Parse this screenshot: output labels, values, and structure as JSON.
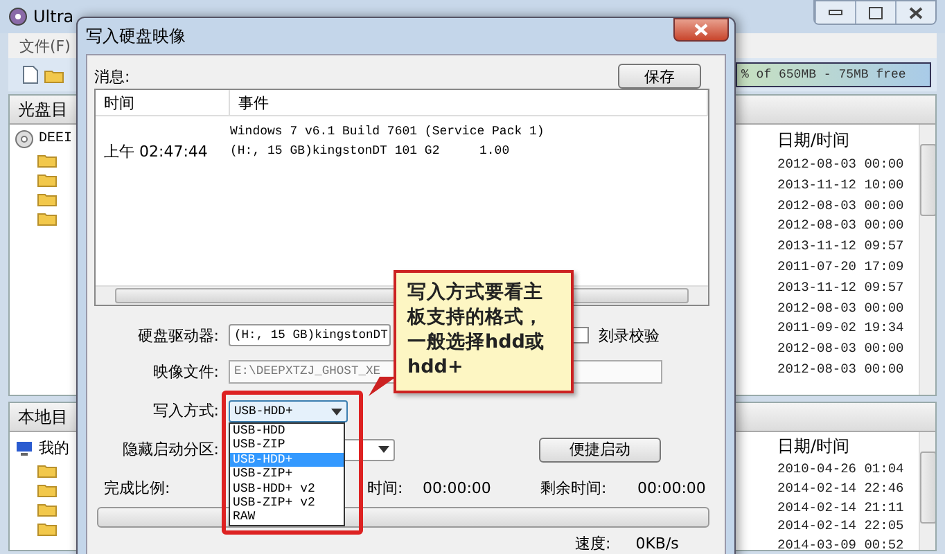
{
  "main_window": {
    "title": "Ultra",
    "menu": [
      "文件(F)"
    ],
    "capacity": "% of 650MB - 75MB free",
    "image_pane": {
      "tab": "光盘目",
      "tree_root": "DEEI",
      "date_header": "日期/时间",
      "dates": [
        "2012-08-03 00:00",
        "2013-11-12 10:00",
        "2012-08-03 00:00",
        "2012-08-03 00:00",
        "2013-11-12 09:57",
        "2011-07-20 17:09",
        "2013-11-12 09:57",
        "2012-08-03 00:00",
        "2011-09-02 19:34",
        "2012-08-03 00:00",
        "2012-08-03 00:00"
      ]
    },
    "local_pane": {
      "tab": "本地目",
      "tree_root": "我的",
      "date_header": "日期/时间",
      "dates": [
        "2010-04-26 01:04",
        "2014-02-14 22:46",
        "2014-02-14 21:11",
        "2014-02-14 22:05",
        "2014-03-09 00:52"
      ]
    }
  },
  "dialog": {
    "title": "写入硬盘映像",
    "messages_label": "消息:",
    "save_button": "保存",
    "log_columns": [
      "时间",
      "事件"
    ],
    "log_rows": [
      {
        "event": "Windows 7 v6.1 Build 7601 (Service Pack 1)"
      },
      {
        "time": "上午 02:47:44",
        "event": "(H:, 15 GB)kingstonDT 101 G2",
        "value": "1.00"
      }
    ],
    "drive_label": "硬盘驱动器:",
    "drive_value": "(H:, 15 GB)kingstonDT",
    "verify": {
      "label": "刻录校验",
      "checked": false
    },
    "image_label": "映像文件:",
    "image_value": "E:\\DEEPXTZJ_GHOST_XE",
    "write_mode": {
      "label": "写入方式:",
      "value": "USB-HDD+",
      "expanded": true,
      "options": [
        {
          "label": "USB-HDD",
          "selected": false
        },
        {
          "label": "USB-ZIP",
          "selected": false
        },
        {
          "label": "USB-HDD+",
          "selected": true
        },
        {
          "label": "USB-ZIP+",
          "selected": false
        },
        {
          "label": "USB-HDD+ v2",
          "selected": false
        },
        {
          "label": "USB-ZIP+ v2",
          "selected": false
        },
        {
          "label": "RAW",
          "selected": false
        }
      ]
    },
    "hidden_label": "隐藏启动分区:",
    "quick_boot_button": "便捷启动",
    "progress_label": "完成比例:",
    "elapsed_label": "时间:",
    "elapsed_value": "00:00:00",
    "remaining_label": "剩余时间:",
    "remaining_value": "00:00:00",
    "progress": {
      "level": 0
    },
    "speed_label": "速度:",
    "speed_value": "0KB/s"
  },
  "callout": {
    "text": "写入方式要看主板支持的格式，一般选择hdd或hdd+"
  }
}
